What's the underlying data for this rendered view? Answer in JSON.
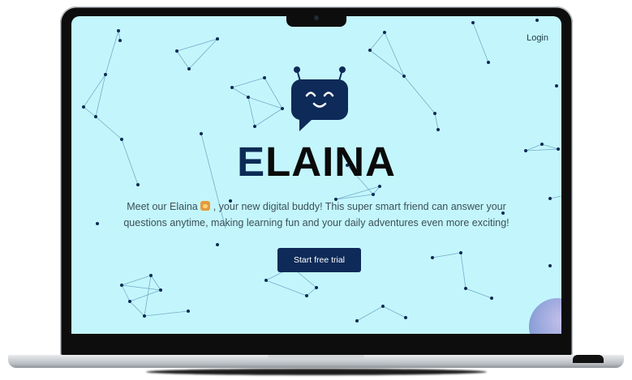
{
  "header": {
    "login_label": "Login"
  },
  "hero": {
    "brand_first_letter": "E",
    "brand_rest": "LAINA",
    "description_part1": "Meet our Elaina",
    "description_part2": ", your new digital buddy! This super smart friend can answer your questions anytime, making learning fun and your daily adventures even more exciting!",
    "cta_label": "Start free trial"
  },
  "icons": {
    "mascot": "robot-chat-bubble-icon",
    "emoji": "character-emoji-icon"
  },
  "colors": {
    "screen_background": "#c3f6fc",
    "primary": "#0e2a58",
    "brand_text": "#0a0a0a",
    "network_lines": "#6aa6c4",
    "network_nodes": "#0d2a55"
  }
}
